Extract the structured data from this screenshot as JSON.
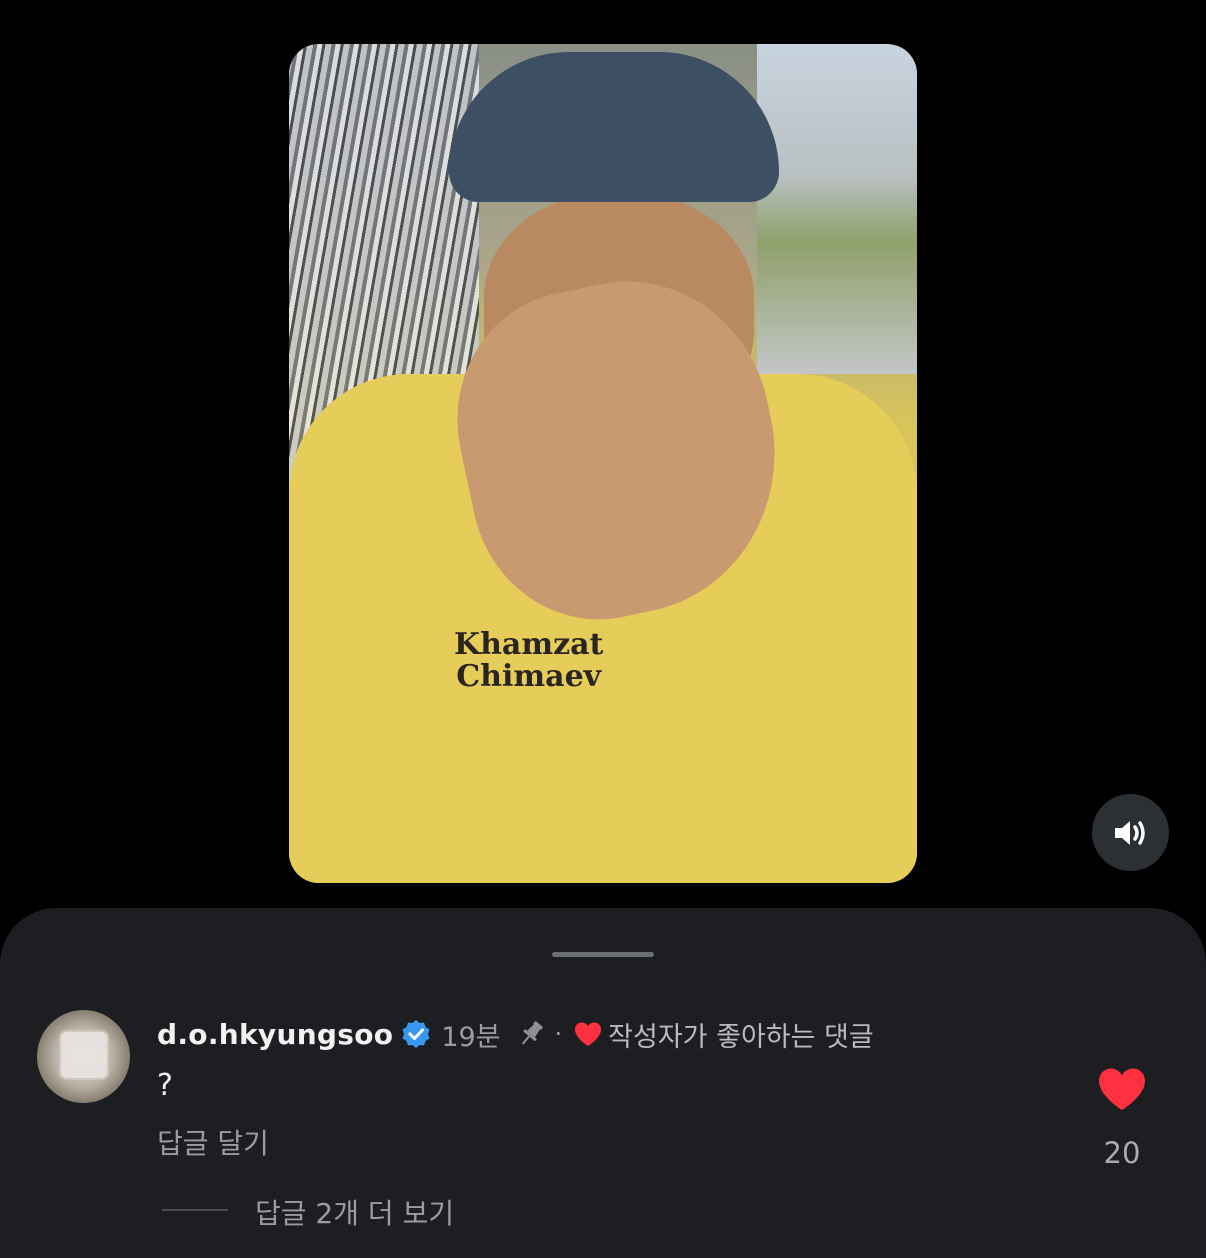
{
  "video": {
    "shirt_print": "Khamzat\nChimaev",
    "sound_icon": "speaker-icon"
  },
  "comment": {
    "username": "d.o.hkyungsoo",
    "verified_icon": "verified-badge-icon",
    "time": "19분",
    "pin_icon": "pin-icon",
    "separator": "·",
    "liked_by_author_label": "작성자가 좋아하는 댓글",
    "text": "?",
    "reply_label": "답글 달기",
    "like_count": "20",
    "more_replies_label": "답글 2개 더 보기"
  },
  "colors": {
    "background": "#000000",
    "sheet": "#1c1e22",
    "heart": "#ff3040",
    "verified": "#3897f0",
    "secondary_text": "#9a9ca1",
    "primary_text": "#f2f2f2"
  }
}
